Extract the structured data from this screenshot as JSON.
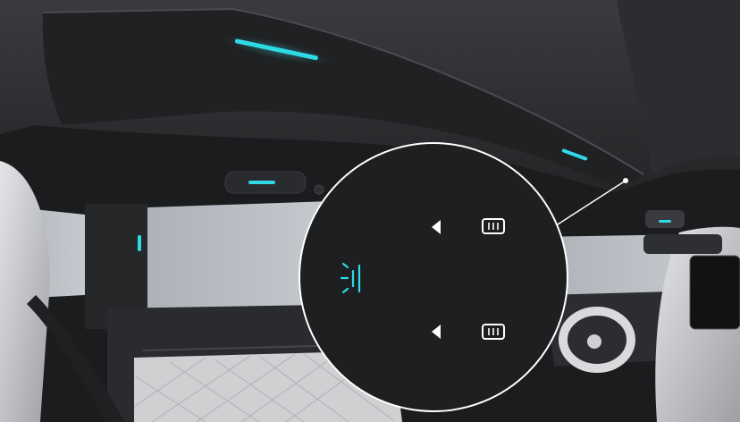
{
  "scene": {
    "subject": "car-interior-roof-lighting",
    "colors": {
      "ambient_light": "#2fd9e6",
      "roof_liner": "#2a2b2d",
      "window": "#b8bcc2",
      "leather": "#d6d7d9",
      "callout_bg": "#1e1f21"
    }
  },
  "callout": {
    "icons": [
      {
        "name": "reading-light-icon",
        "color": "#2fd9e6"
      },
      {
        "name": "arrow-left-icon",
        "color": "#ffffff"
      },
      {
        "name": "button-icon",
        "color": "#ffffff"
      }
    ]
  }
}
